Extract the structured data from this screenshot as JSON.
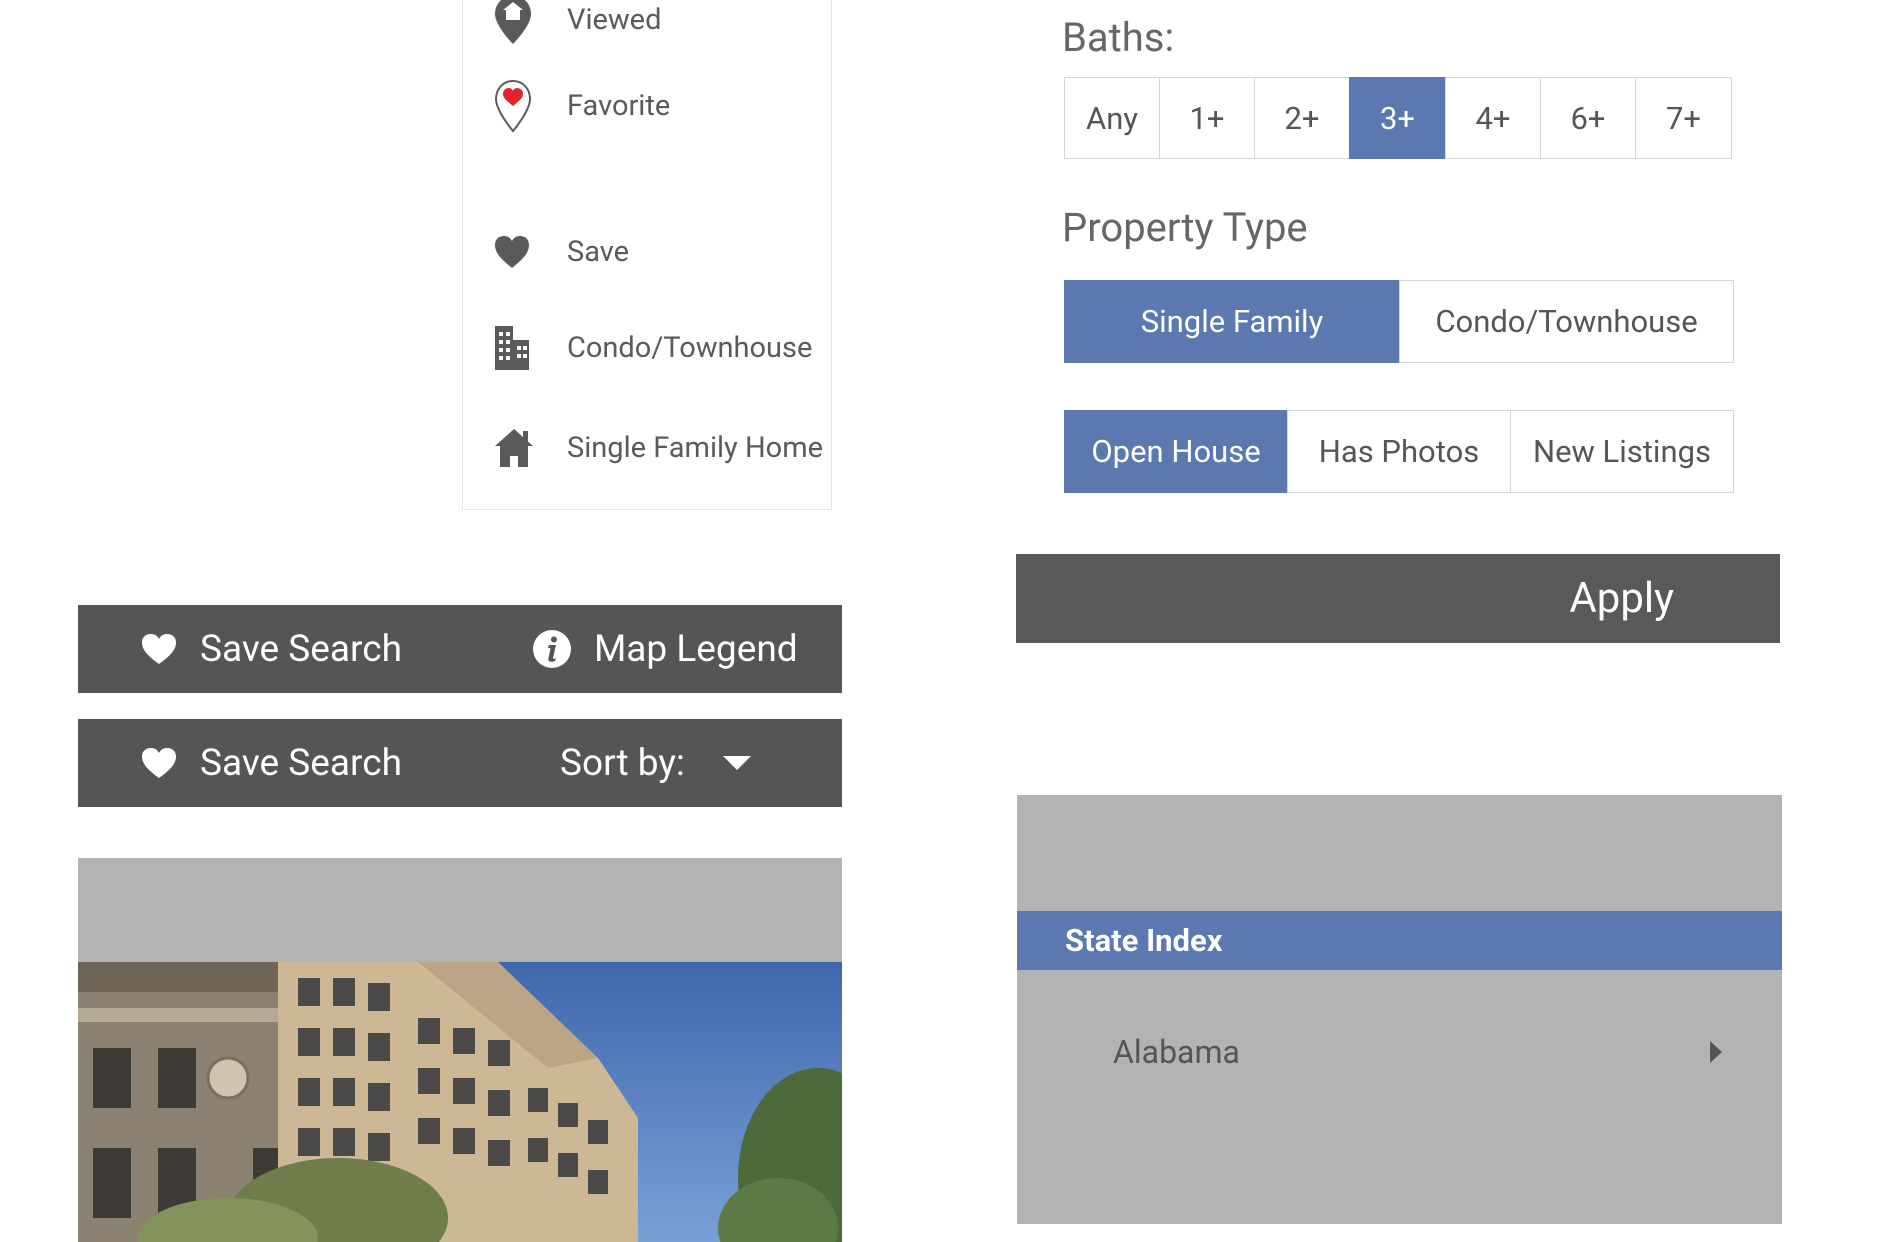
{
  "legend": {
    "items": [
      {
        "label": "Viewed",
        "icon": "viewed-pin-icon"
      },
      {
        "label": "Favorite",
        "icon": "favorite-pin-icon"
      },
      {
        "label": "Save",
        "icon": "heart-icon"
      },
      {
        "label": "Condo/Townhouse",
        "icon": "building-icon"
      },
      {
        "label": "Single Family Home",
        "icon": "house-icon"
      }
    ]
  },
  "toolbar1": {
    "save_label": "Save Search",
    "legend_label": "Map Legend"
  },
  "toolbar2": {
    "save_label": "Save Search",
    "sort_label": "Sort by:"
  },
  "filters": {
    "baths_title": "Baths:",
    "baths_options": [
      "Any",
      "1+",
      "2+",
      "3+",
      "4+",
      "6+",
      "7+"
    ],
    "baths_selected": "3+",
    "property_type_title": "Property Type",
    "property_types": [
      "Single Family",
      "Condo/Townhouse"
    ],
    "property_type_selected": "Single Family",
    "listing_filters": [
      "Open House",
      "Has Photos",
      "New Listings"
    ],
    "listing_filter_selected": "Open House",
    "apply_label": "Apply"
  },
  "state_index": {
    "title": "State Index",
    "states": [
      "Alabama"
    ]
  },
  "colors": {
    "accent": "#5b79b0",
    "bar": "#555555",
    "panel": "#b2b3b5"
  }
}
